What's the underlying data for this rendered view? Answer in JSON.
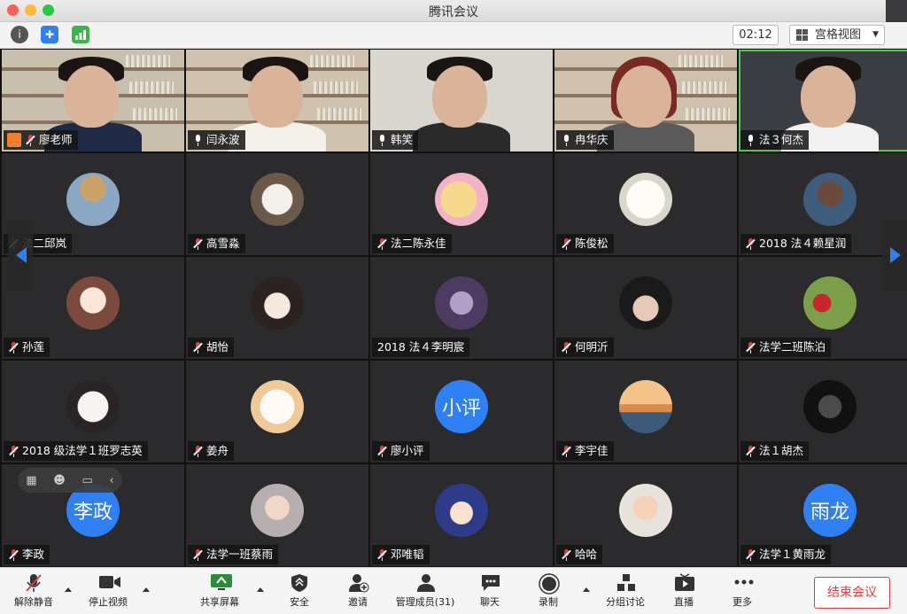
{
  "window": {
    "title": "腾讯会议"
  },
  "infobar": {
    "timer": "02:12",
    "view_label": "宫格视图"
  },
  "colors": {
    "accent": "#2f7ff5",
    "end": "#e03c3c",
    "active": "#4ec94e"
  },
  "participants": [
    {
      "name": "廖老师",
      "muted": true,
      "kind": "video",
      "host": true
    },
    {
      "name": "闫永波",
      "muted": false,
      "kind": "video"
    },
    {
      "name": "韩笑",
      "muted": false,
      "kind": "video"
    },
    {
      "name": "冉华庆",
      "muted": false,
      "kind": "video"
    },
    {
      "name": "法３何杰",
      "muted": false,
      "kind": "video",
      "active": true
    },
    {
      "name": "法二邱岚",
      "muted": true,
      "kind": "avatar",
      "avatar": "giraffe-avatar"
    },
    {
      "name": "高雪淼",
      "muted": true,
      "kind": "avatar",
      "avatar": "puppy-avatar"
    },
    {
      "name": "法二陈永佳",
      "muted": true,
      "kind": "avatar",
      "avatar": "cartoon-bear-avatar"
    },
    {
      "name": "陈俊松",
      "muted": true,
      "kind": "avatar",
      "avatar": "sketch-man-avatar"
    },
    {
      "name": "2018 法４赖星润",
      "muted": true,
      "kind": "avatar",
      "avatar": "man-photo-avatar"
    },
    {
      "name": "孙莲",
      "muted": true,
      "kind": "avatar",
      "avatar": "anime-girl-avatar"
    },
    {
      "name": "胡怡",
      "muted": true,
      "kind": "avatar",
      "avatar": "woman-photo-avatar"
    },
    {
      "name": "2018 法４李明宸",
      "muted": null,
      "kind": "avatar",
      "avatar": "purple-art-avatar"
    },
    {
      "name": "何明沂",
      "muted": true,
      "kind": "avatar",
      "avatar": "helmet-girl-avatar"
    },
    {
      "name": "法学二班陈泊",
      "muted": true,
      "kind": "avatar",
      "avatar": "red-figure-avatar"
    },
    {
      "name": "2018 级法学１班罗志英",
      "muted": true,
      "kind": "avatar",
      "avatar": "sketch-girl-avatar"
    },
    {
      "name": "姜舟",
      "muted": true,
      "kind": "avatar",
      "avatar": "bunny-avatar"
    },
    {
      "name": "廖小评",
      "muted": true,
      "kind": "text",
      "avatar_text": "小评"
    },
    {
      "name": "李宇佳",
      "muted": true,
      "kind": "avatar",
      "avatar": "sunset-avatar"
    },
    {
      "name": "法１胡杰",
      "muted": true,
      "kind": "avatar",
      "avatar": "dark-screen-avatar"
    },
    {
      "name": "李政",
      "muted": true,
      "kind": "text",
      "avatar_text": "李政"
    },
    {
      "name": "法学一班蔡雨",
      "muted": true,
      "kind": "avatar",
      "avatar": "baby-avatar"
    },
    {
      "name": "邓唯韬",
      "muted": true,
      "kind": "avatar",
      "avatar": "anime-boy-avatar"
    },
    {
      "name": "哈哈",
      "muted": true,
      "kind": "avatar",
      "avatar": "toddler-avatar"
    },
    {
      "name": "法学１黄雨龙",
      "muted": true,
      "kind": "text",
      "avatar_text": "雨龙"
    }
  ],
  "toolbar": {
    "unmute": "解除静音",
    "stop_video": "停止视频",
    "share_screen": "共享屏幕",
    "security": "安全",
    "invite": "邀请",
    "participants": "管理成员(31)",
    "chat": "聊天",
    "record": "录制",
    "breakout": "分组讨论",
    "live": "直播",
    "more": "更多",
    "end_meeting": "结束会议"
  }
}
